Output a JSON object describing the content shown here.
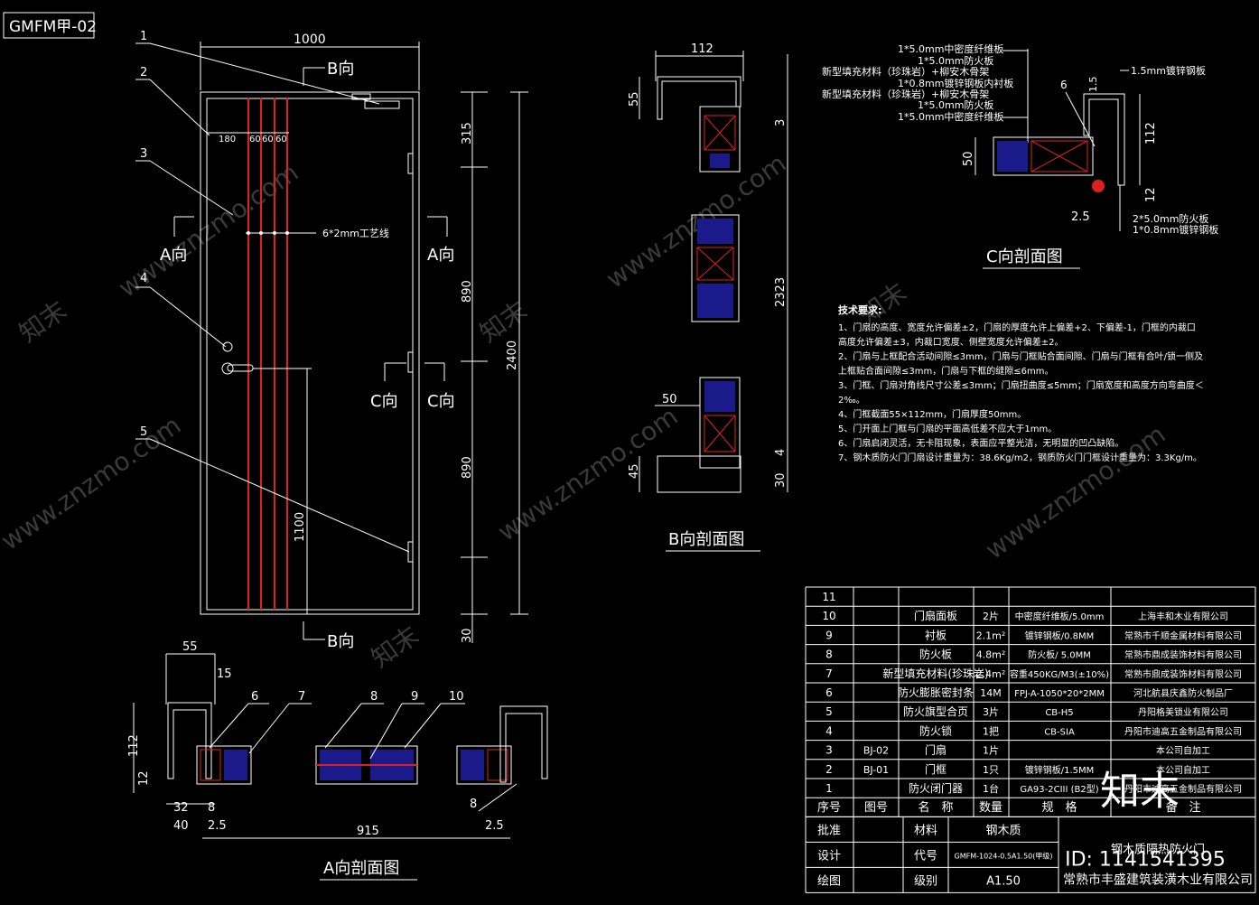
{
  "drawing_id": "GMFM甲-02",
  "elevation": {
    "width_dim": "1000",
    "dims_right": [
      "315",
      "890",
      "890",
      "30"
    ],
    "total_height": "2400",
    "handle_height": "1100",
    "top_offsets": [
      "180",
      "60",
      "60",
      "60"
    ],
    "groove_note": "6*2mm工艺线",
    "callouts": [
      "1",
      "2",
      "3",
      "4",
      "5"
    ],
    "view_b_top": "B向",
    "view_b_bottom": "B向",
    "view_a_left": "A向",
    "view_a_right": "A向",
    "view_c_left": "C向",
    "view_c_right": "C向"
  },
  "section_b": {
    "title": "B向剖面图",
    "dims": [
      "112",
      "55",
      "3",
      "2323",
      "50",
      "45",
      "4",
      "30"
    ]
  },
  "section_a": {
    "title": "A向剖面图",
    "dims": [
      "55",
      "15",
      "112",
      "12",
      "32",
      "8",
      "40",
      "2.5",
      "915",
      "2.5",
      "8"
    ],
    "callouts": [
      "6",
      "7",
      "8",
      "9",
      "10",
      "8"
    ]
  },
  "section_c": {
    "title": "C向剖面图",
    "layers": [
      "1*5.0mm中密度纤维板",
      "1*5.0mm防火板",
      "新型填充材料（珍珠岩）+柳安木骨架",
      "1*0.8mm镀锌钢板内衬板",
      "新型填充材料（珍珠岩）+柳安木骨架",
      "1*5.0mm防火板",
      "1*5.0mm中密度纤维板"
    ],
    "frame_note": "1.5mm镀锌钢板",
    "dims": [
      "1.5",
      "112",
      "50",
      "12",
      "2.5"
    ],
    "callout": "6",
    "bottom_notes": [
      "2*5.0mm防火板",
      "1*0.8mm镀锌钢板"
    ]
  },
  "tech_requirements": {
    "title": "技术要求:",
    "lines": [
      "1、门扇的高度、宽度允许偏差±2，门扇的厚度允许上偏差+2、下偏差-1，门框的内裁口",
      "高度允许偏差±3，内裁口宽度、侧壁宽度允许偏差±2。",
      "2、门扇与上框配合活动间隙≤3mm，门扇与门框贴合面间隙、门扇与门框有合叶/锁一侧及",
      "上框贴合面间隙≤3mm，门扇与下框的缝隙≤6mm。",
      "3、门框、门扇对角线尺寸公差≤3mm；门扇扭曲度≤5mm；门扇宽度和高度方向弯曲度＜",
      "2‰。",
      "4、门框截面55×112mm，门扇厚度50mm。",
      "5、门开面上门框与门扇的平面高低差不应大于1mm。",
      "6、门扇启闭灵活，无卡阻现象，表面应平整光洁，无明显的凹凸缺陷。",
      "7、钢木质防火门门扇设计重量为：38.6Kg/m2，钢质防火门门框设计重量为：3.3Kg/m。"
    ]
  },
  "bom": {
    "rows": [
      [
        "11",
        "",
        "",
        "",
        "",
        ""
      ],
      [
        "10",
        "",
        "门扇面板",
        "2片",
        "中密度纤维板/5.0mm",
        "上海丰和木业有限公司"
      ],
      [
        "9",
        "",
        "衬板",
        "2.1m²",
        "镀锌钢板/0.8MM",
        "常熟市千顺金属材料有限公司"
      ],
      [
        "8",
        "",
        "防火板",
        "4.8m²",
        "防火板/ 5.0MM",
        "常熟市鼎成装饰材料有限公司"
      ],
      [
        "7",
        "",
        "新型填充材料(珍珠岩)",
        "2.4m²",
        "容重450KG/M3(±10%)",
        "常熟市鼎成装饰材料有限公司"
      ],
      [
        "6",
        "",
        "防火膨胀密封条",
        "14M",
        "FPJ-A-1050*20*2MM",
        "河北航县庆鑫防火制品厂"
      ],
      [
        "5",
        "",
        "防火旗型合页",
        "3片",
        "CB-H5",
        "丹阳格美锁业有限公司"
      ],
      [
        "4",
        "",
        "防火锁",
        "1把",
        "CB-SIA",
        "丹阳市迪高五金制品有限公司"
      ],
      [
        "3",
        "BJ-02",
        "门扇",
        "1片",
        "",
        "本公司自加工"
      ],
      [
        "2",
        "BJ-01",
        "门框",
        "1只",
        "镀锌钢板/1.5MM",
        "本公司自加工"
      ],
      [
        "1",
        "",
        "防火闭门器",
        "1台",
        "GA93-2CIII (B2型)",
        "丹阳市迪高五金制品有限公司"
      ]
    ],
    "header": [
      "序号",
      "图号",
      "名　称",
      "数量",
      "规　格",
      "备　注"
    ],
    "title_block": {
      "approve_label": "批准",
      "design_label": "设计",
      "draw_label": "绘图",
      "material_label": "材料",
      "material_value": "钢木质",
      "code_label": "代号",
      "code_value": "GMFM-1024-0.5A1.50(甲级)",
      "grade_label": "级别",
      "grade_value": "A1.50",
      "product_name": "钢木质隔热防火门",
      "company": "常熟市丰盛建筑装潢木业有限公司"
    }
  },
  "watermark": {
    "logo": "知末",
    "id": "ID: 1141541395",
    "url": "www.znzmo.com"
  }
}
